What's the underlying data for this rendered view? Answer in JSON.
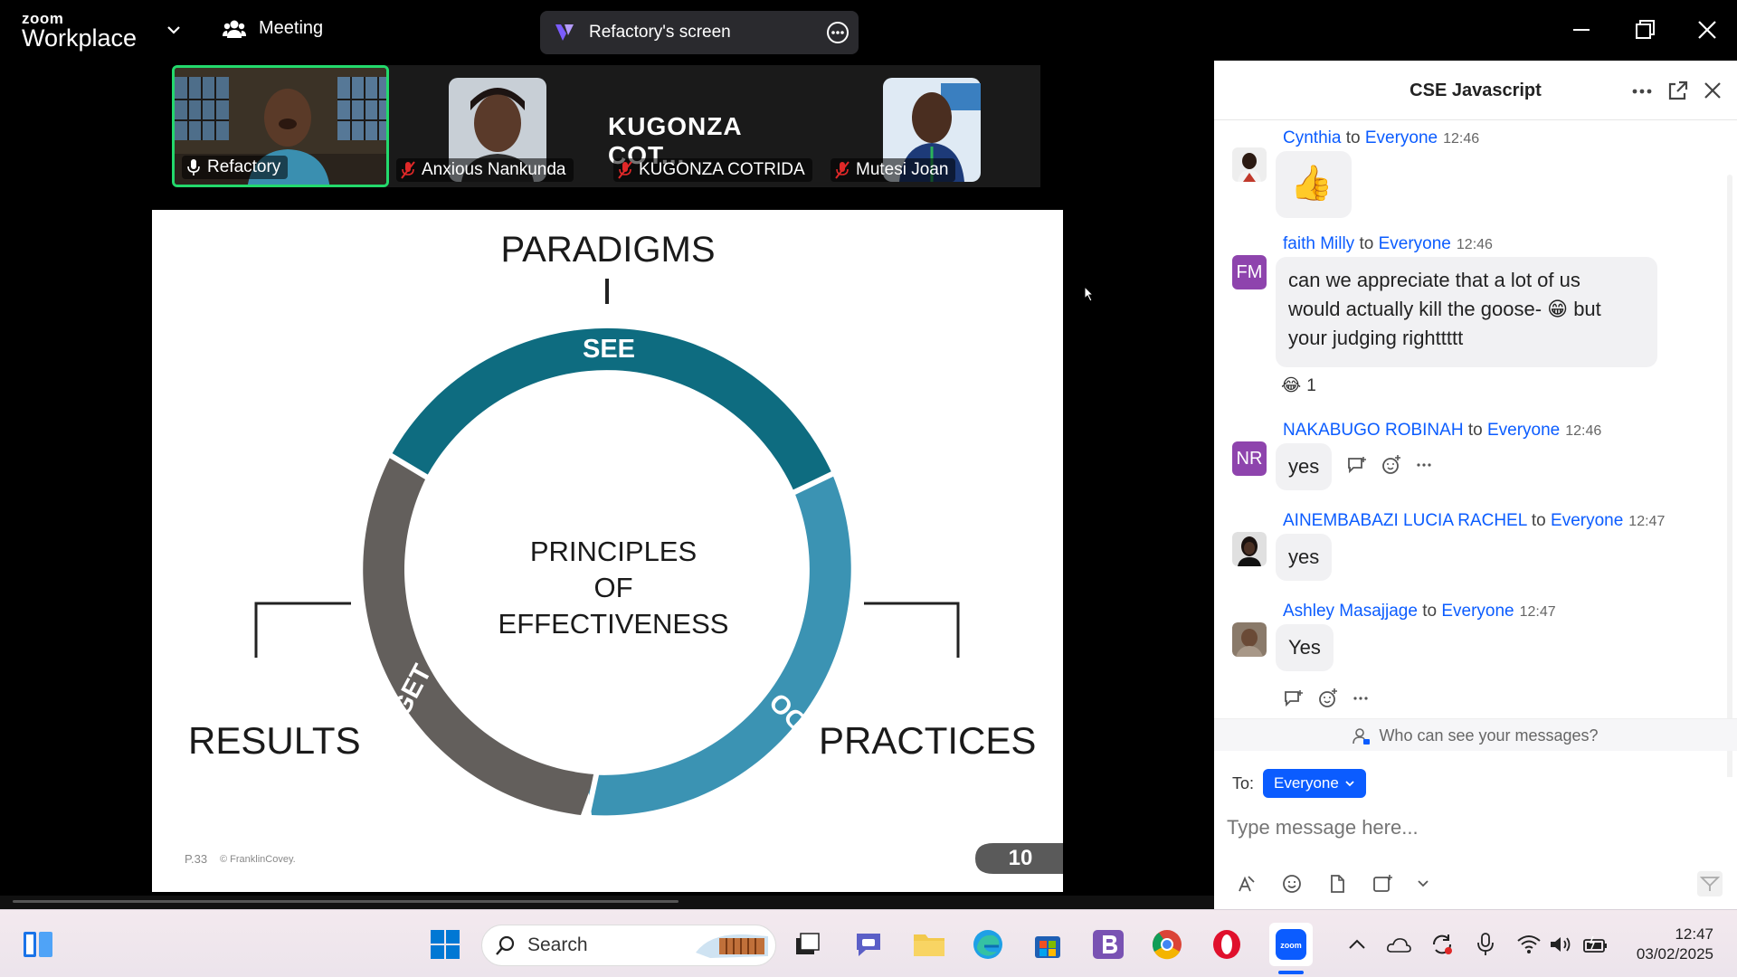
{
  "app": {
    "logo_top": "zoom",
    "logo_bottom": "Workplace",
    "meeting_label": "Meeting",
    "screen_share_label": "Refactory's screen"
  },
  "participants": [
    {
      "name": "Refactory"
    },
    {
      "name": "Anxious Nankunda"
    },
    {
      "name": "KUGONZA COTRIDA",
      "display": "KUGONZA  COT..."
    },
    {
      "name": "Mutesi Joan"
    }
  ],
  "slide": {
    "top_label": "PARADIGMS",
    "center_line1": "PRINCIPLES",
    "center_line2": "OF EFFECTIVENESS",
    "seg_see": "SEE",
    "seg_do": "DO",
    "seg_get": "GET",
    "left_label": "RESULTS",
    "right_label": "PRACTICES",
    "footer_page": "P.33",
    "footer_copy": "© FranklinCovey.",
    "slide_number": "10",
    "colors": {
      "see": "#0e6c80",
      "do": "#3b93b3",
      "get": "#635f5c"
    }
  },
  "chat": {
    "title": "CSE Javascript",
    "messages": [
      {
        "sender": "Cynthia",
        "to_word": "to",
        "recipient": "Everyone",
        "time": "12:46",
        "text": "👍"
      },
      {
        "sender": "faith Milly",
        "to_word": "to",
        "recipient": "Everyone",
        "time": "12:46",
        "initials": "FM",
        "line1": "can we appreciate that a lot of us",
        "line2": "would actually kill the goose- 😁 but",
        "line3": "your judging righttttt",
        "reaction": "😂",
        "reaction_count": "1"
      },
      {
        "sender": "NAKABUGO ROBINAH",
        "to_word": "to",
        "recipient": "Everyone",
        "time": "12:46",
        "initials": "NR",
        "text": "yes"
      },
      {
        "sender": "AINEMBABAZI LUCIA RACHEL",
        "to_word": "to",
        "recipient": "Everyone",
        "time": "12:47",
        "text": "yes"
      },
      {
        "sender": "Ashley Masajjage",
        "to_word": "to",
        "recipient": "Everyone",
        "time": "12:47",
        "text": "Yes"
      }
    ],
    "who_can_see": "Who can see your messages?",
    "to_label": "To:",
    "to_value": "Everyone",
    "input_placeholder": "Type message here..."
  },
  "taskbar": {
    "search_label": "Search",
    "time": "12:47",
    "date": "03/02/2025"
  }
}
